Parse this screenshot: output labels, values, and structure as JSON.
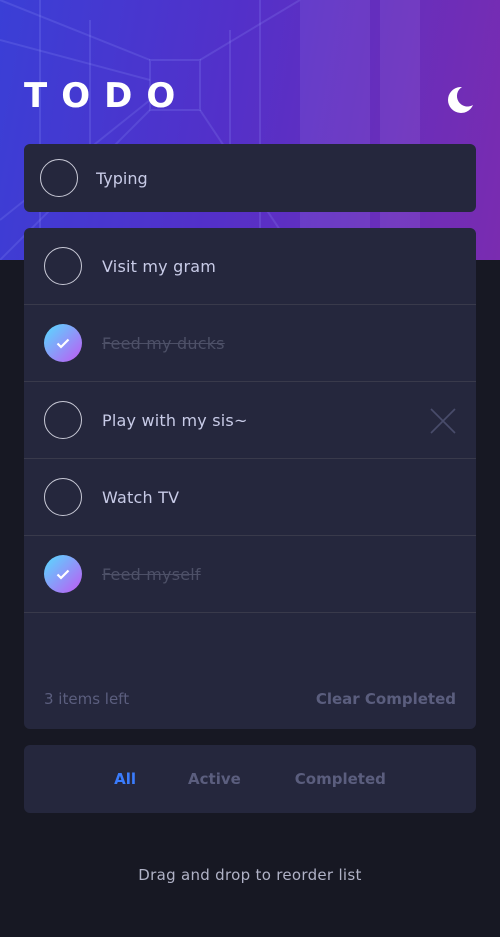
{
  "header": {
    "title": "TODO",
    "theme_icon": "moon-icon"
  },
  "new_todo": {
    "value": "Typing"
  },
  "todos": [
    {
      "label": "Visit my gram",
      "completed": false
    },
    {
      "label": "Feed my ducks",
      "completed": true
    },
    {
      "label": "Play with my sis~",
      "completed": false
    },
    {
      "label": "Watch TV",
      "completed": false
    },
    {
      "label": "Feed myself",
      "completed": true
    }
  ],
  "footer": {
    "items_left": "3 items left",
    "clear_label": "Clear Completed"
  },
  "filters": {
    "all": "All",
    "active": "Active",
    "completed": "Completed",
    "selected": "All"
  },
  "hint": "Drag and drop to reorder list",
  "colors": {
    "accent": "#3a7cfd",
    "check_gradient_start": "#55ddff",
    "check_gradient_end": "#c058f3",
    "card": "#25273d",
    "background": "#171823"
  }
}
